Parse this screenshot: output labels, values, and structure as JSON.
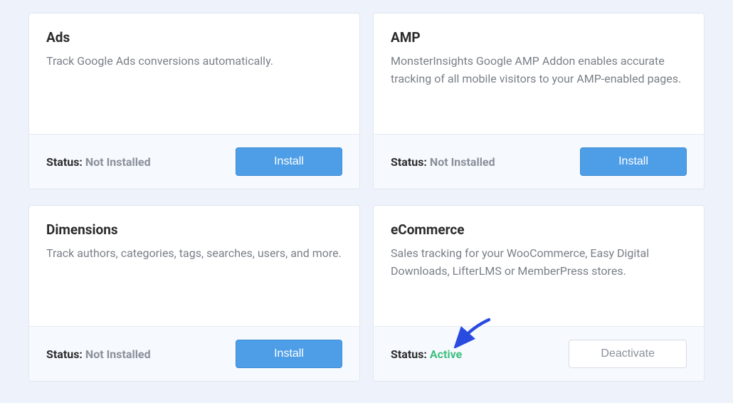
{
  "status_label": "Status:",
  "cards": [
    {
      "title": "Ads",
      "description": "Track Google Ads conversions automatically.",
      "status": "Not Installed",
      "status_active": false,
      "button": "Install",
      "button_variant": "primary"
    },
    {
      "title": "AMP",
      "description": "MonsterInsights Google AMP Addon enables accurate tracking of all mobile visitors to your AMP-enabled pages.",
      "status": "Not Installed",
      "status_active": false,
      "button": "Install",
      "button_variant": "primary"
    },
    {
      "title": "Dimensions",
      "description": "Track authors, categories, tags, searches, users, and more.",
      "status": "Not Installed",
      "status_active": false,
      "button": "Install",
      "button_variant": "primary"
    },
    {
      "title": "eCommerce",
      "description": "Sales tracking for your WooCommerce, Easy Digital Downloads, LifterLMS or MemberPress stores.",
      "status": "Active",
      "status_active": true,
      "button": "Deactivate",
      "button_variant": "secondary"
    }
  ]
}
